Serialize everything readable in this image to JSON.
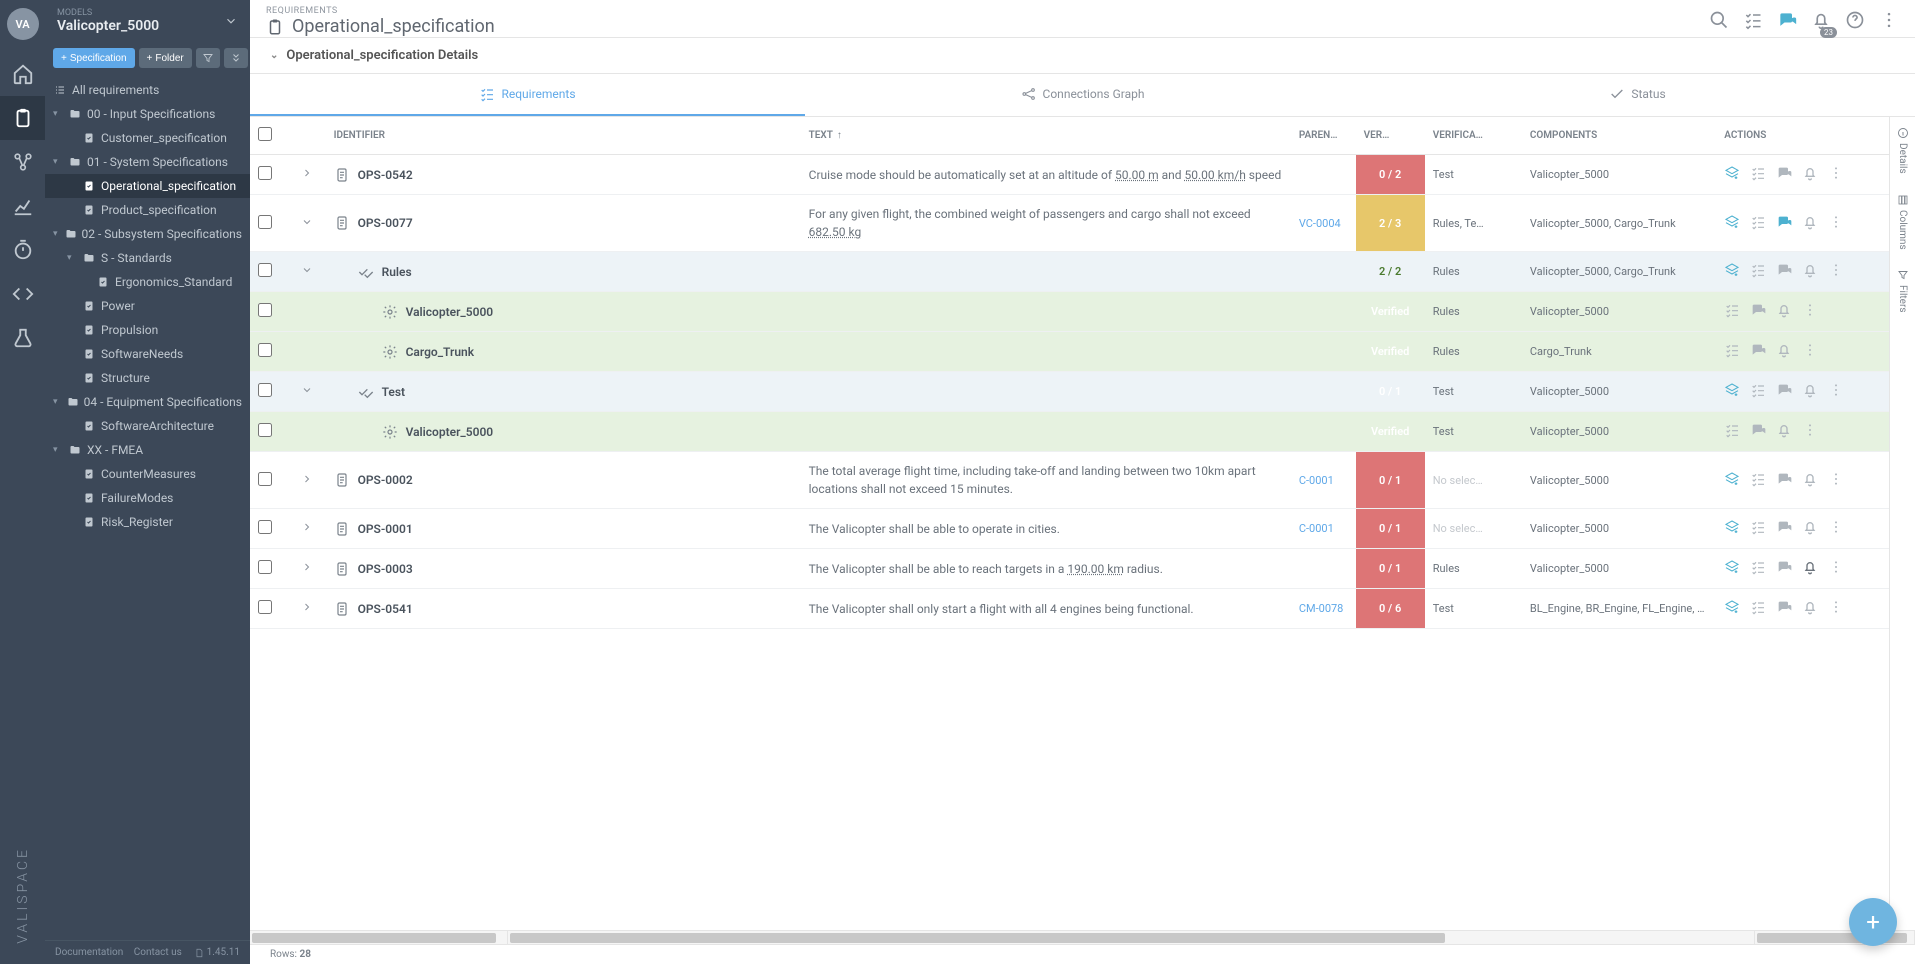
{
  "avatar": "VA",
  "model_label": "MODELS",
  "model_name": "Valicopter_5000",
  "buttons": {
    "spec": "Specification",
    "folder": "Folder"
  },
  "tree": {
    "all": "All requirements",
    "items": [
      {
        "label": "00 - Input Specifications",
        "depth": 1,
        "type": "folder",
        "expanded": true
      },
      {
        "label": "Customer_specification",
        "depth": 2,
        "type": "spec"
      },
      {
        "label": "01 - System Specifications",
        "depth": 1,
        "type": "folder",
        "expanded": true
      },
      {
        "label": "Operational_specification",
        "depth": 2,
        "type": "spec",
        "selected": true
      },
      {
        "label": "Product_specification",
        "depth": 2,
        "type": "spec"
      },
      {
        "label": "02 - Subsystem Specifications",
        "depth": 1,
        "type": "folder",
        "expanded": true
      },
      {
        "label": "S - Standards",
        "depth": 2,
        "type": "folder",
        "expanded": true
      },
      {
        "label": "Ergonomics_Standard",
        "depth": 3,
        "type": "spec"
      },
      {
        "label": "Power",
        "depth": 2,
        "type": "spec"
      },
      {
        "label": "Propulsion",
        "depth": 2,
        "type": "spec"
      },
      {
        "label": "SoftwareNeeds",
        "depth": 2,
        "type": "spec"
      },
      {
        "label": "Structure",
        "depth": 2,
        "type": "spec"
      },
      {
        "label": "04 - Equipment Specifications",
        "depth": 1,
        "type": "folder",
        "expanded": true
      },
      {
        "label": "SoftwareArchitecture",
        "depth": 2,
        "type": "spec"
      },
      {
        "label": "XX - FMEA",
        "depth": 1,
        "type": "folder",
        "expanded": true
      },
      {
        "label": "CounterMeasures",
        "depth": 2,
        "type": "spec"
      },
      {
        "label": "FailureModes",
        "depth": 2,
        "type": "spec"
      },
      {
        "label": "Risk_Register",
        "depth": 2,
        "type": "spec"
      }
    ]
  },
  "footer": {
    "doc": "Documentation",
    "contact": "Contact us",
    "version": "1.45.11"
  },
  "breadcrumb": "REQUIREMENTS",
  "page_title": "Operational_specification",
  "details_title": "Operational_specification Details",
  "notif_badge": "23",
  "tabs": {
    "req": "Requirements",
    "conn": "Connections Graph",
    "status": "Status"
  },
  "columns": {
    "ident": "Identifier",
    "text": "Text",
    "parent": "Paren…",
    "ver": "Ver…",
    "method": "Verifica…",
    "comp": "Components",
    "actions": "Actions"
  },
  "rows": [
    {
      "kind": "req",
      "ident": "OPS-0542",
      "text_pre": "Cruise mode should be automatically set at an altitude of ",
      "text_ul1": "50.00 m",
      "text_mid": " and ",
      "text_ul2": "50.00 km/h",
      "text_post": " speed",
      "parent": "",
      "ver": "0 / 2",
      "ver_class": "ver-red",
      "method": "Test",
      "comp": "Valicopter_5000",
      "expandable": true,
      "actions": "std"
    },
    {
      "kind": "req",
      "ident": "OPS-0077",
      "text_pre": "For any given flight, the combined weight of passengers and cargo shall not exceed ",
      "text_ul1": "682.50 kg",
      "text_post": "",
      "parent": "VC-0004",
      "ver": "2 / 3",
      "ver_class": "ver-yellow",
      "method": "Rules, Te…",
      "comp": "Valicopter_5000, Cargo_Trunk",
      "expandable": true,
      "expanded": true,
      "actions": "chat"
    },
    {
      "kind": "group",
      "indent": 1,
      "icon": "check",
      "ident": "Rules",
      "ver": "2 / 2",
      "ver_class": "ver-green-light",
      "method": "Rules",
      "comp": "Valicopter_5000, Cargo_Trunk",
      "expandable": true,
      "expanded": true,
      "row_class": "child",
      "actions": "std"
    },
    {
      "kind": "leaf",
      "indent": 2,
      "icon": "gear",
      "ident": "Valicopter_5000",
      "ver": "Verified",
      "ver_class": "ver-green",
      "method": "Rules",
      "comp": "Valicopter_5000",
      "row_class": "verified-row",
      "actions": "leaf"
    },
    {
      "kind": "leaf",
      "indent": 2,
      "icon": "gear",
      "ident": "Cargo_Trunk",
      "ver": "Verified",
      "ver_class": "ver-green",
      "method": "Rules",
      "comp": "Cargo_Trunk",
      "row_class": "verified-row",
      "actions": "leaf"
    },
    {
      "kind": "group",
      "indent": 1,
      "icon": "check",
      "ident": "Test",
      "ver": "0 / 1",
      "ver_class": "ver-red",
      "method": "Test",
      "comp": "Valicopter_5000",
      "expandable": true,
      "expanded": true,
      "row_class": "child",
      "actions": "std"
    },
    {
      "kind": "leaf",
      "indent": 2,
      "icon": "gear",
      "ident": "Valicopter_5000",
      "ver": "Verified",
      "ver_class": "ver-green",
      "method": "Test",
      "comp": "Valicopter_5000",
      "row_class": "verified-row",
      "actions": "leaf"
    },
    {
      "kind": "req",
      "ident": "OPS-0002",
      "text_pre": "The total average flight time, including take-off and landing between two 10km apart locations shall not exceed 15 minutes.",
      "parent": "C-0001",
      "ver": "0 / 1",
      "ver_class": "ver-red",
      "method": "No selec…",
      "method_class": "no-sel",
      "comp": "Valicopter_5000",
      "expandable": true,
      "actions": "std"
    },
    {
      "kind": "req",
      "ident": "OPS-0001",
      "text_pre": "The Valicopter shall be able to operate in cities.",
      "parent": "C-0001",
      "ver": "0 / 1",
      "ver_class": "ver-red",
      "method": "No selec…",
      "method_class": "no-sel",
      "comp": "Valicopter_5000",
      "expandable": true,
      "actions": "std"
    },
    {
      "kind": "req",
      "ident": "OPS-0003",
      "text_pre": "The Valicopter shall be able to reach targets in a ",
      "text_ul1": "190.00 km",
      "text_post": " radius.",
      "parent": "",
      "ver": "0 / 1",
      "ver_class": "ver-red",
      "method": "Rules",
      "comp": "Valicopter_5000",
      "expandable": true,
      "actions": "bell"
    },
    {
      "kind": "req",
      "ident": "OPS-0541",
      "text_pre": "The Valicopter shall only start a flight with all 4 engines being functional.",
      "parent": "CM-0078",
      "ver": "0 / 6",
      "ver_class": "ver-red",
      "method": "Test",
      "comp": "BL_Engine, BR_Engine, FL_Engine, …",
      "expandable": true,
      "actions": "std"
    }
  ],
  "right_rail": {
    "details": "Details",
    "columns": "Columns",
    "filters": "Filters"
  },
  "rows_label": "Rows:",
  "rows_count": "28"
}
